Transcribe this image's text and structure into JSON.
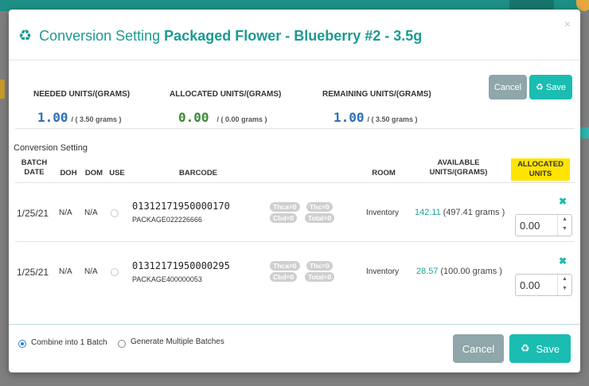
{
  "modal": {
    "title_prefix": "Conversion Setting",
    "title_product": "Packaged Flower - Blueberry #2 - 3.5g",
    "close": "×"
  },
  "summary": {
    "needed_label": "NEEDED UNITS/(GRAMS)",
    "needed_value": "1.00",
    "needed_grams": "/ ( 3.50 grams )",
    "allocated_label": "ALLOCATED UNITS/(GRAMS)",
    "allocated_value": "0.00",
    "allocated_grams": "/ ( 0.00 grams )",
    "remaining_label": "REMAINING UNITS/(GRAMS)",
    "remaining_value": "1.00",
    "remaining_grams": "/ ( 3.50 grams )"
  },
  "top_buttons": {
    "cancel": "Cancel",
    "save": "Save"
  },
  "section_title": "Conversion Setting",
  "columns": {
    "batch_date": "BATCH DATE",
    "doh": "DOH",
    "dom": "DOM",
    "use": "USE",
    "barcode": "BARCODE",
    "room": "ROOM",
    "available": "AVAILABLE UNITS/(GRAMS)",
    "allocated": "ALLOCATED UNITS"
  },
  "rows": [
    {
      "date": "1/25/21",
      "doh": "N/A",
      "dom": "N/A",
      "barcode": "01312171950000170",
      "package": "PACKAGE022226666",
      "thca": "Thca=0",
      "thc": "Thc=0",
      "cbd": "Cbd=0",
      "total": "Total=0",
      "room": "Inventory",
      "avail_units": "142.11",
      "avail_grams": "(497.41 grams )",
      "allocated": "0.00",
      "remove": "✖"
    },
    {
      "date": "1/25/21",
      "doh": "N/A",
      "dom": "N/A",
      "barcode": "01312171950000295",
      "package": "PACKAGE400000053",
      "thca": "Thca=0",
      "thc": "Thc=0",
      "cbd": "Cbd=0",
      "total": "Total=0",
      "room": "Inventory",
      "avail_units": "28.57",
      "avail_grams": "(100.00 grams )",
      "allocated": "0.00",
      "remove": "✖"
    }
  ],
  "footer": {
    "combine_label": "Combine into 1 Batch",
    "combine_selected": true,
    "multiple_label": "Generate Multiple Batches",
    "cancel": "Cancel",
    "save": "Save"
  },
  "colors": {
    "accent": "#1bbcb1",
    "title": "#1d9a92",
    "needed_value": "#2f6fb8",
    "allocated_value": "#3a8a3a",
    "allocated_header_bg": "#ffe400"
  },
  "icons": {
    "recycle": "♻",
    "save": "♻",
    "spinner_up": "▲",
    "spinner_down": "▼"
  }
}
